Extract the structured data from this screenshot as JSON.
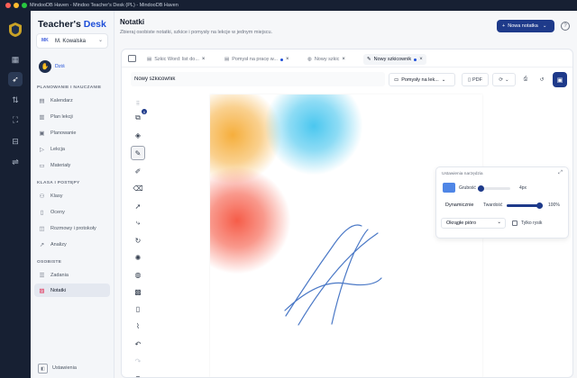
{
  "window": {
    "title": "MindooDB Haven - Mindoo Teacher's Desk (PL) - MindooDB Haven"
  },
  "brand": {
    "part1": "Teacher's ",
    "part2": "Desk"
  },
  "user": {
    "initials": "MK",
    "name": "M. Kowalska"
  },
  "sidebar": {
    "today": "Dziś",
    "sections": [
      {
        "title": "PLANOWANIE I NAUCZANIE",
        "items": [
          "Kalendarz",
          "Plan lekcji",
          "Planowanie",
          "Lekcja",
          "Materiały"
        ]
      },
      {
        "title": "KLASA I POSTĘPY",
        "items": [
          "Klasy",
          "Oceny",
          "Rozmowy i protokoły",
          "Analizy"
        ]
      },
      {
        "title": "OSOBISTE",
        "items": [
          "Zadania",
          "Notatki"
        ]
      }
    ],
    "active_item": "Notatki",
    "settings": "Ustawienia"
  },
  "main": {
    "title": "Notatki",
    "subtitle": "Zbieraj osobiste notatki, szkice i pomysły na lekcje w jednym miejscu.",
    "new_note": "Nowa notatka"
  },
  "tabs": [
    {
      "label": "Szkic Word: list do...",
      "active": false
    },
    {
      "label": "Pomysł na pracę w...",
      "active": false
    },
    {
      "label": "Nowy szkic",
      "active": false
    },
    {
      "label": "Nowy szkicownik",
      "active": true
    }
  ],
  "toolbar": {
    "name_value": "Nowy szkicownik",
    "folder": "Pomysły na lek...",
    "pdf": "PDF"
  },
  "tools": {
    "badge": "0",
    "icons": [
      "grip-icon",
      "layers-icon",
      "stack-icon",
      "pen-icon",
      "highlighter-icon",
      "eraser-icon",
      "select-icon",
      "curve-icon",
      "lasso-icon",
      "laser-icon",
      "palette-icon",
      "image-icon",
      "page-icon",
      "attach-icon",
      "undo-icon",
      "redo-icon",
      "zoom-in-icon"
    ]
  },
  "popup": {
    "title": "Ustawienia narzędzia",
    "color": "#4f86e6",
    "width_label": "Grubość",
    "width_value": "4px",
    "width_level": 0.08,
    "dynamic_label": "Dynamicznie",
    "hardness_label": "Twardość",
    "hardness_value": "100%",
    "hardness_level": 1.0,
    "tip_label": "Okrągłe pióro",
    "stylus_label": "Tylko rysik"
  },
  "colors": {
    "accent": "#1e3a8a",
    "link": "#1d4ed8",
    "orange": "#f5b341",
    "cyan": "#41c4ee",
    "red": "#f5543f",
    "stroke": "#4a78c6"
  }
}
